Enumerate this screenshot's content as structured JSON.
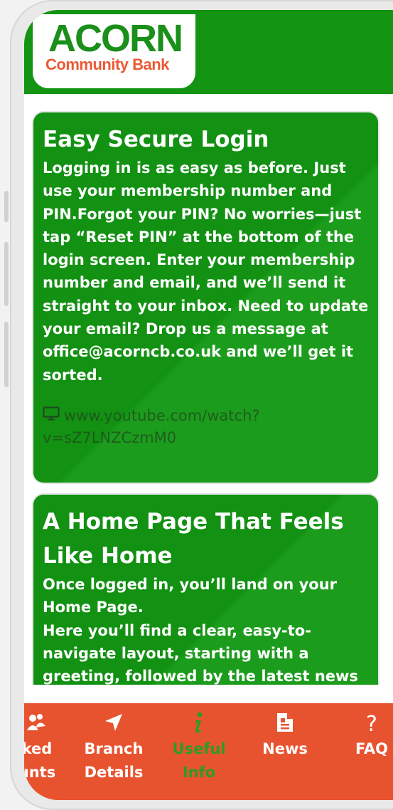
{
  "brand": {
    "name": "ACORN",
    "sub": "Community Bank"
  },
  "cards": [
    {
      "title": "Easy Secure Login",
      "body": "Logging in is as easy as before. Just use your membership number and PIN.Forgot your PIN? No worries—just tap “Reset PIN” at the bottom of the login screen. Enter your membership number and email, and we’ll send it straight to your inbox. Need to update your email? Drop us a message at office@acorncb.co.uk and we’ll get it sorted.",
      "link": "www.youtube.com/watch?v=sZ7LNZCzmM0"
    },
    {
      "title": "A Home Page That Feels Like Home",
      "body1": "Once logged in, you’ll land on your Home Page.",
      "body2": "Here you’ll find a clear, easy-to-navigate layout, starting with a greeting, followed by the latest news"
    }
  ],
  "nav": {
    "items": [
      {
        "line1": "ked",
        "line2": "unts",
        "icon": "linked-accounts-icon"
      },
      {
        "line1": "Branch",
        "line2": "Details",
        "icon": "location-arrow-icon"
      },
      {
        "line1": "Useful",
        "line2": "Info",
        "icon": "info-icon",
        "active": true
      },
      {
        "line1": "News",
        "line2": "",
        "icon": "news-icon"
      },
      {
        "line1": "FAQ",
        "line2": "",
        "icon": "question-icon"
      }
    ]
  },
  "colors": {
    "green": "#139413",
    "orange": "#e8532f",
    "active_nav": "#2e9b22",
    "logo_green": "#1a8f1a",
    "logo_orange": "#ea5b35"
  }
}
